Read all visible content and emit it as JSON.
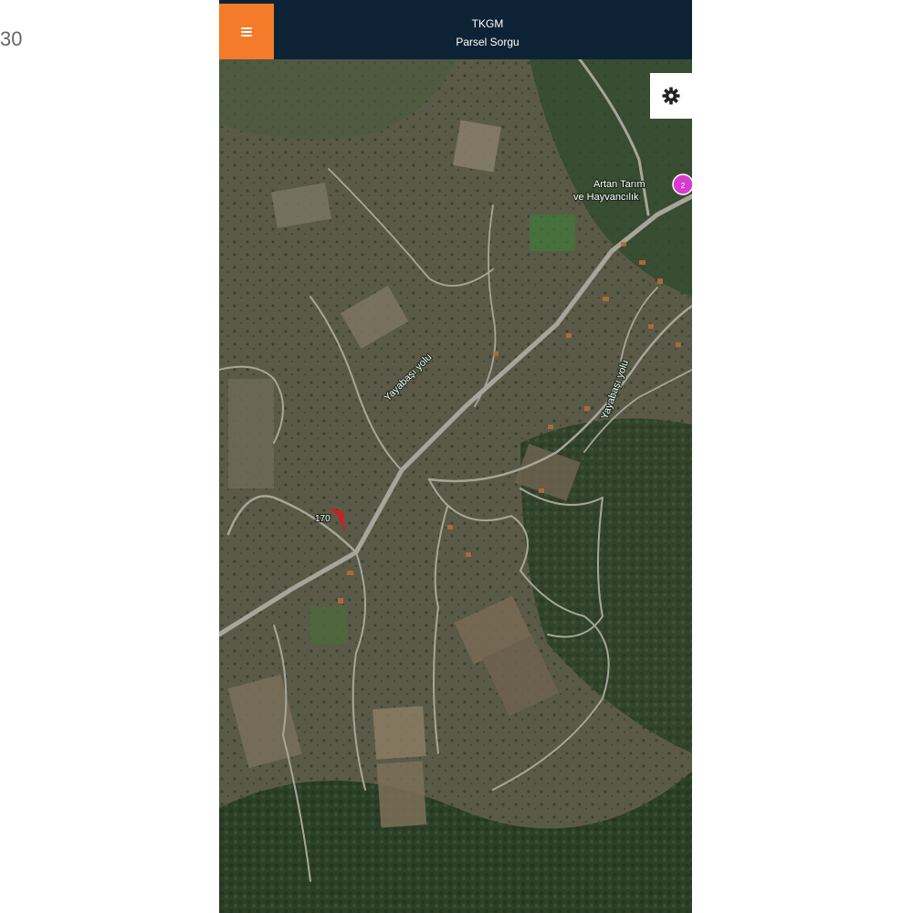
{
  "outer": {
    "label": "30"
  },
  "header": {
    "menu_icon": "hamburger-icon",
    "title": "TKGM",
    "subtitle": "Parsel Sorgu"
  },
  "settings": {
    "icon": "gear-icon"
  },
  "map": {
    "place_name_line1": "Artan Tarım",
    "place_name_line2": "ve Hayvancılık",
    "place_marker_text": "2",
    "road_label_1": "Yayabaşı yolu",
    "road_label_2": "Yayabaşı yolu",
    "pin_label": "170",
    "colors": {
      "header_bg": "#0e2235",
      "menu_accent": "#f47b2a",
      "place_marker": "#d63bd0",
      "pin": "#c8202a"
    }
  }
}
